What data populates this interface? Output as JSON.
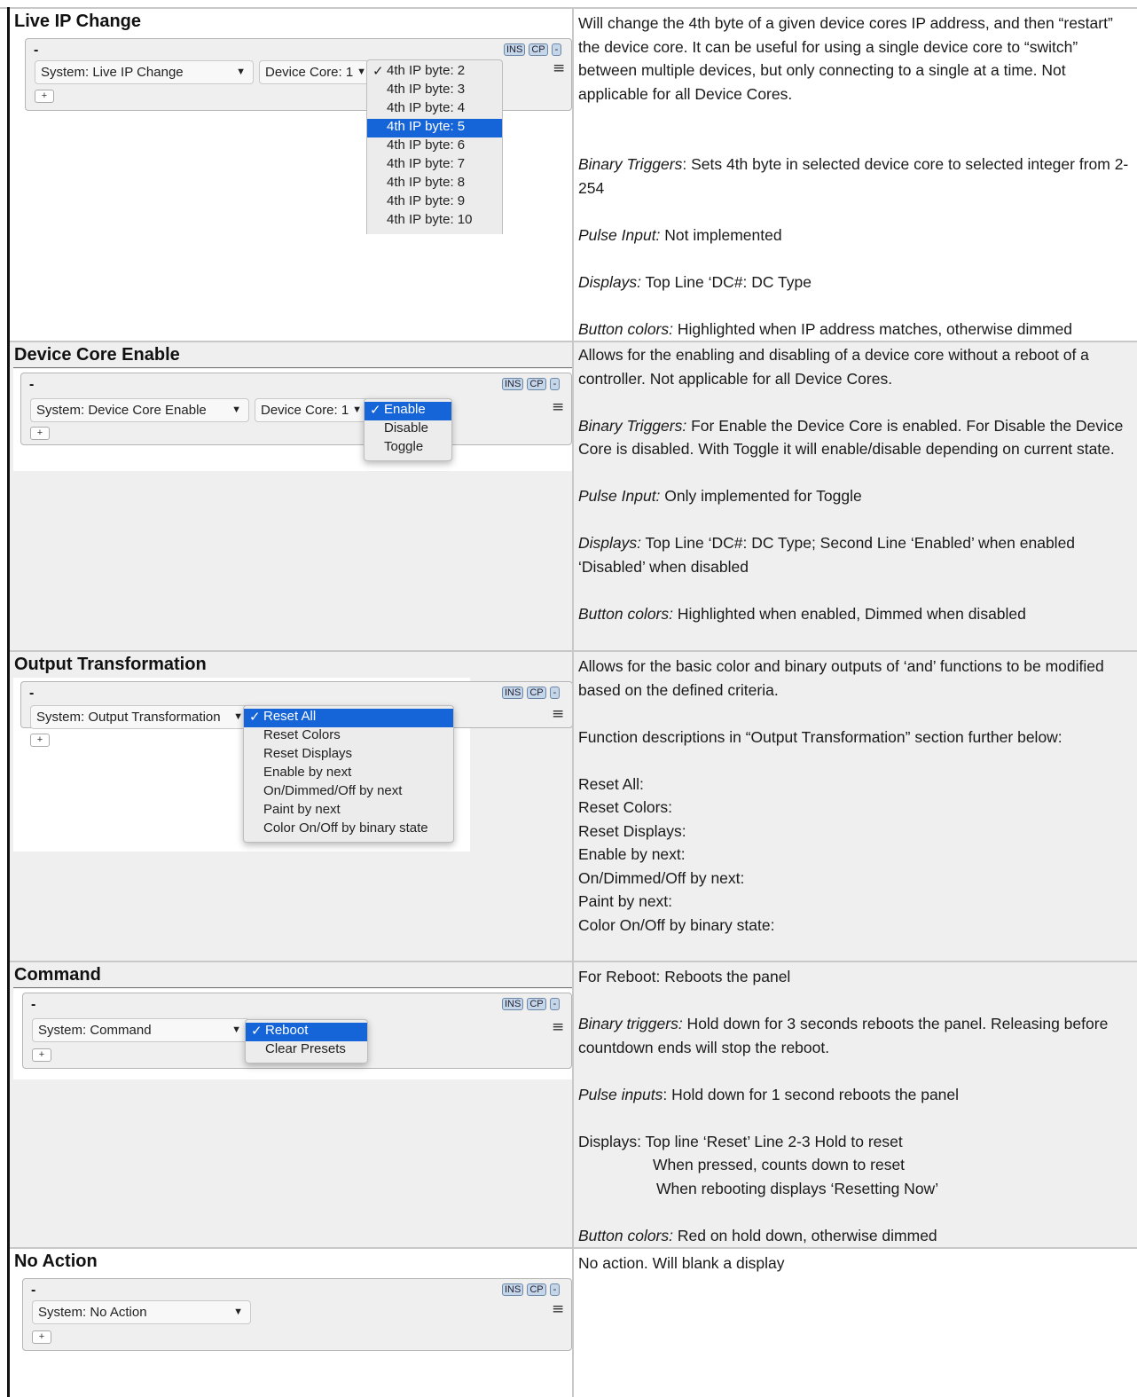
{
  "sections": {
    "live_ip": {
      "title": "Live IP Change",
      "panel": {
        "dash": "-",
        "btn_ins": "INS",
        "btn_cp": "CP",
        "btn_minus": "-",
        "select_main": "System: Live IP Change",
        "select_core": "Device Core: 1",
        "plus": "+",
        "menu": "≡"
      },
      "dropdown": [
        "4th IP byte: 2",
        "4th IP byte: 3",
        "4th IP byte: 4",
        "4th IP byte: 5",
        "4th IP byte: 6",
        "4th IP byte: 7",
        "4th IP byte: 8",
        "4th IP byte: 9",
        "4th IP byte: 10"
      ],
      "desc": {
        "intro": "Will change the 4th byte of a given device cores IP address, and then “restart” the device core. It can be useful for using a single device core to “switch” between multiple devices, but only connecting to a single at a time. Not applicable for all Device Cores.",
        "binary_label": "Binary Triggers",
        "binary_text": ": Sets 4th byte in selected device core to selected integer from 2-254",
        "pulse_label": "Pulse Input:",
        "pulse_text": " Not implemented",
        "displays_label": "Displays:",
        "displays_text": " Top Line ‘DC#: DC Type",
        "colors_label": "Button colors:",
        "colors_text": " Highlighted when IP address matches, otherwise dimmed"
      }
    },
    "dce": {
      "title": "Device Core Enable",
      "panel": {
        "dash": "-",
        "btn_ins": "INS",
        "btn_cp": "CP",
        "btn_minus": "-",
        "select_main": "System: Device Core Enable",
        "select_core": "Device Core: 1",
        "plus": "+",
        "menu": "≡"
      },
      "dropdown": [
        "Enable",
        "Disable",
        "Toggle"
      ],
      "desc": {
        "intro": "Allows for the enabling and disabling of a device core without a reboot of a controller. Not applicable for all Device Cores.",
        "binary_label": "Binary Triggers:",
        "binary_text": " For Enable the Device Core is enabled. For Disable the Device Core is disabled. With Toggle it will enable/disable depending on current state.",
        "pulse_label": "Pulse Input:",
        "pulse_text": " Only implemented for Toggle",
        "displays_label": "Displays:",
        "displays_text": " Top Line ‘DC#: DC Type; Second Line ‘Enabled’ when enabled ‘Disabled’ when disabled",
        "colors_label": "Button colors:",
        "colors_text": " Highlighted when enabled, Dimmed when disabled"
      }
    },
    "ot": {
      "title": "Output Transformation",
      "panel": {
        "dash": "-",
        "btn_ins": "INS",
        "btn_cp": "CP",
        "btn_minus": "-",
        "select_main": "System: Output Transformation",
        "plus": "+",
        "menu": "≡"
      },
      "dropdown": [
        "Reset All",
        "Reset Colors",
        "Reset Displays",
        "Enable by next",
        "On/Dimmed/Off by next",
        "Paint by next",
        "Color On/Off by binary state"
      ],
      "desc": {
        "intro": "Allows for the basic color and binary outputs of  ‘and’ functions to be modified based on the defined criteria.",
        "functions": "Function descriptions in “Output Transformation” section further below:",
        "list": [
          "Reset All:",
          "Reset Colors:",
          "Reset Displays:",
          "Enable by next:",
          "On/Dimmed/Off by next:",
          "Paint by next:",
          "Color On/Off by binary state:"
        ]
      }
    },
    "cmd": {
      "title": "Command",
      "panel": {
        "dash": "-",
        "btn_ins": "INS",
        "btn_cp": "CP",
        "btn_minus": "-",
        "select_main": "System: Command",
        "plus": "+",
        "menu": "≡"
      },
      "dropdown": [
        "Reboot",
        "Clear Presets"
      ],
      "desc": {
        "intro": "For Reboot: Reboots the panel",
        "binary_label": "Binary triggers:",
        "binary_text": " Hold down for 3 seconds reboots the panel. Releasing before countdown ends will stop the reboot.",
        "pulse_label": "Pulse inputs",
        "pulse_text": ": Hold down for 1 second reboots the panel",
        "displays_line1": "Displays: Top line ‘Reset’ Line 2-3 Hold to reset",
        "displays_line2": "When pressed, counts down to reset",
        "displays_line3": "When rebooting displays ‘Resetting Now’",
        "colors_label": "Button colors:",
        "colors_text": " Red on hold down, otherwise dimmed"
      }
    },
    "noa": {
      "title": "No Action",
      "panel": {
        "dash": "-",
        "btn_ins": "INS",
        "btn_cp": "CP",
        "btn_minus": "-",
        "select_main": "System: No Action",
        "plus": "+",
        "menu": "≡"
      },
      "desc": {
        "intro": "No action. Will blank a display"
      }
    }
  },
  "check_mark": "✓",
  "caret": "▼",
  "colors": {
    "selected": "#1665d8",
    "shaded_row": "#efefef",
    "button": "#c4d6e8"
  }
}
